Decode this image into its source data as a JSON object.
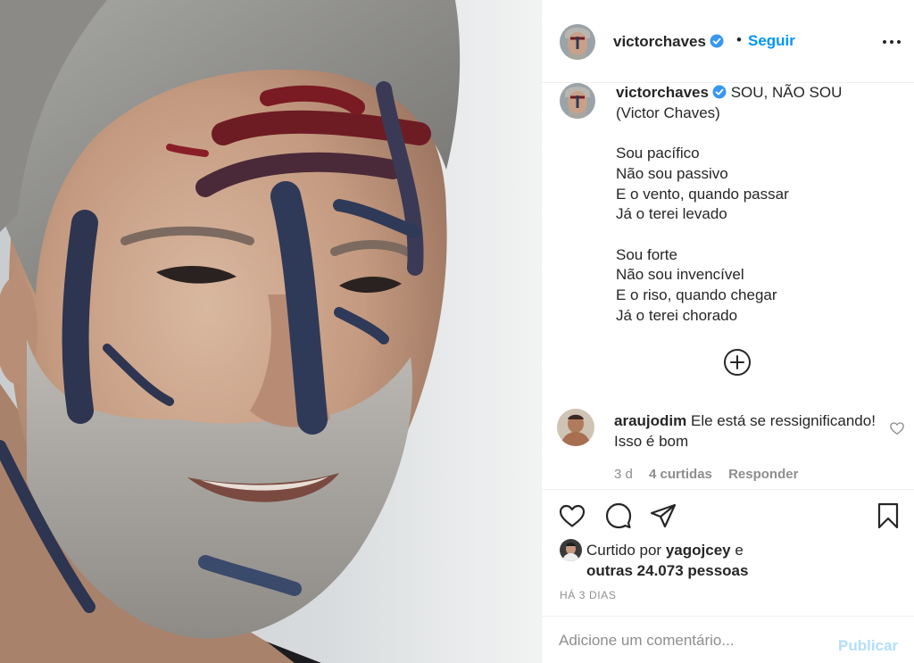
{
  "post": {
    "image_alt": "Close-up of a smiling man with grey hair and beard, face painted with dark blue and red brush strokes"
  },
  "header": {
    "username": "victorchaves",
    "verified_icon": "verified-badge-icon",
    "separator": "•",
    "follow_label": "Seguir",
    "more_icon": "more-options-icon"
  },
  "caption": {
    "username": "victorchaves",
    "title": "SOU, NÃO SOU",
    "author": "(Victor Chaves)",
    "stanza1": [
      "Sou pacífico",
      "Não sou passivo",
      "E o vento, quando passar",
      "Já o terei levado"
    ],
    "stanza2": [
      "Sou forte",
      "Não sou invencível",
      "E o riso, quando chegar",
      "Já o terei chorado"
    ]
  },
  "load_more_icon": "plus-circle-icon",
  "comment": {
    "username": "araujodim",
    "text": "Ele está se ressignificando! Isso é bom",
    "time": "3 d",
    "likes": "4 curtidas",
    "reply": "Responder"
  },
  "likes": {
    "prefix": "Curtido por",
    "user": "yagojcey",
    "conj": "e",
    "others": "outras 24.073 pessoas"
  },
  "time_ago": "HÁ 3 DIAS",
  "add_comment": {
    "placeholder": "Adicione um comentário...",
    "publish_label": "Publicar"
  },
  "colors": {
    "accent": "#0095f6",
    "publish_disabled": "#b2dffc",
    "muted": "#8e8e8e",
    "text": "#262626"
  }
}
